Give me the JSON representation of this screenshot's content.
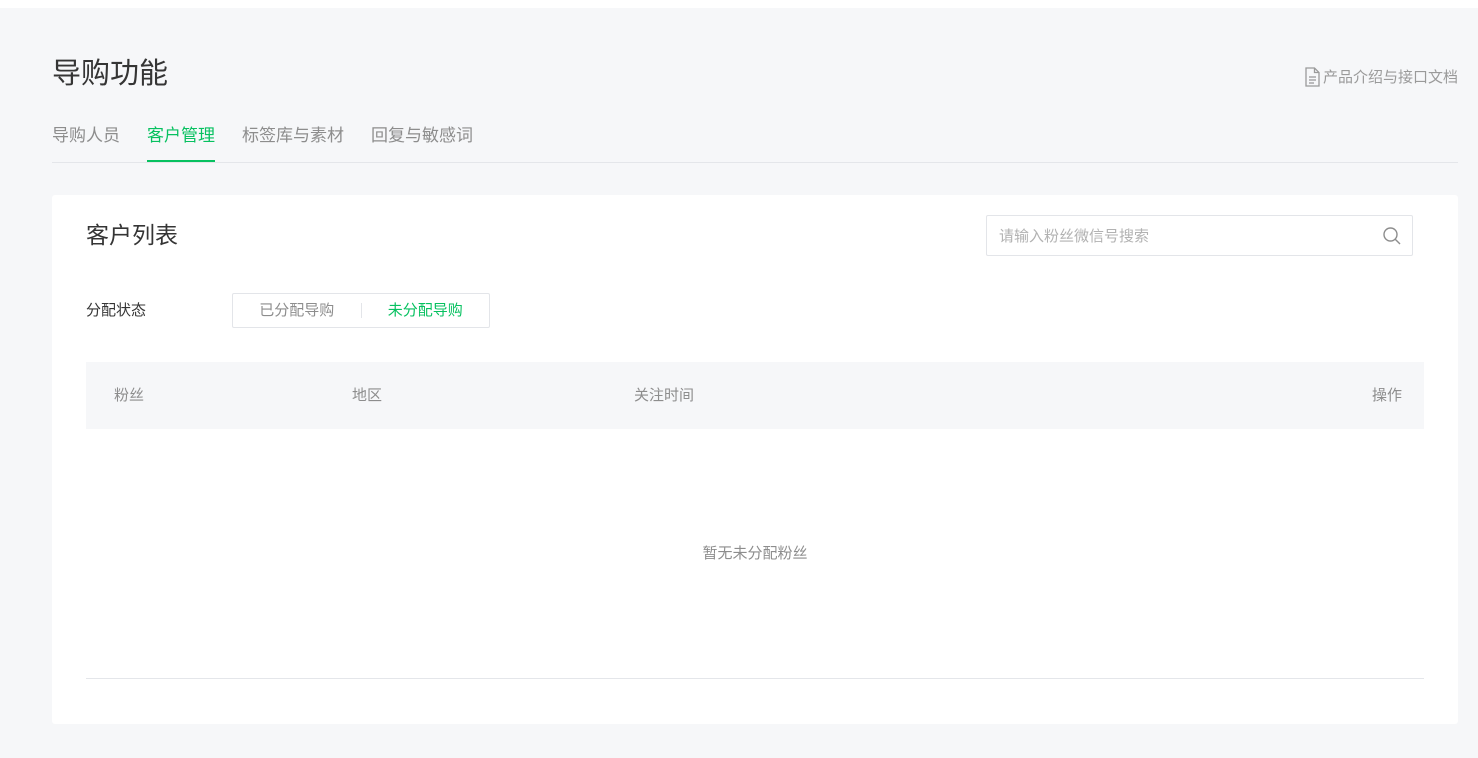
{
  "header": {
    "title": "导购功能",
    "doc_link": "产品介绍与接口文档"
  },
  "tabs": [
    {
      "label": "导购人员",
      "active": false
    },
    {
      "label": "客户管理",
      "active": true
    },
    {
      "label": "标签库与素材",
      "active": false
    },
    {
      "label": "回复与敏感词",
      "active": false
    }
  ],
  "card": {
    "title": "客户列表",
    "search": {
      "placeholder": "请输入粉丝微信号搜索",
      "value": ""
    },
    "filter": {
      "label": "分配状态",
      "options": [
        {
          "label": "已分配导购",
          "active": false
        },
        {
          "label": "未分配导购",
          "active": true
        }
      ]
    },
    "table": {
      "columns": [
        "粉丝",
        "地区",
        "关注时间",
        "操作"
      ],
      "rows": [],
      "empty_text": "暂无未分配粉丝"
    }
  },
  "colors": {
    "accent": "#07c160",
    "background": "#f6f7f9",
    "muted_text": "#8d8d8d"
  }
}
